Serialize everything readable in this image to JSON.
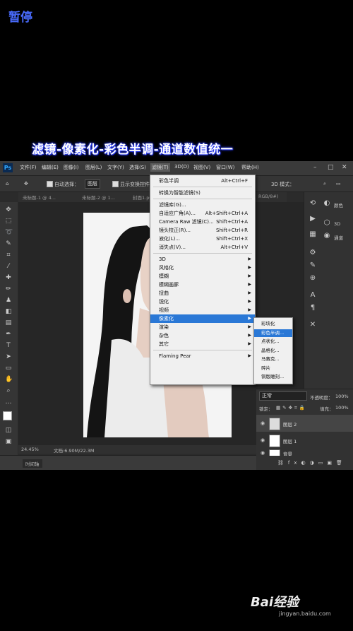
{
  "overlay": {
    "pause_label": "暂停",
    "caption": "滤镜-像素化-彩色半调-通道数值统一"
  },
  "app": {
    "logo": "Ps",
    "menus": [
      "文件(F)",
      "编辑(E)",
      "图像(I)",
      "图层(L)",
      "文字(Y)",
      "选择(S)",
      "滤镜(T)",
      "3D(D)",
      "视图(V)",
      "窗口(W)",
      "帮助(H)"
    ],
    "active_menu_index": 6
  },
  "options_bar": {
    "auto_select_label": "自动选择：",
    "auto_select_value": "图层",
    "show_transform_label": "显示变换控件",
    "mode_3d_label": "3D 模式："
  },
  "tabs": [
    "未标题-1 @ 4...",
    "未标题-2 @ 1...",
    "封面1.psd",
    "RGB/8#)"
  ],
  "status": {
    "zoom": "24.45%",
    "doc_size": "文档:6.90M/22.3M",
    "timeline_label": "时间轴"
  },
  "filter_menu": {
    "items": [
      {
        "label": "彩色半调",
        "shortcut": "Alt+Ctrl+F"
      },
      {
        "sep": true
      },
      {
        "label": "转换为智能滤镜(S)"
      },
      {
        "sep": true
      },
      {
        "label": "滤镜库(G)..."
      },
      {
        "label": "自适应广角(A)...",
        "shortcut": "Alt+Shift+Ctrl+A"
      },
      {
        "label": "Camera Raw 滤镜(C)...",
        "shortcut": "Shift+Ctrl+A"
      },
      {
        "label": "镜头校正(R)...",
        "shortcut": "Shift+Ctrl+R"
      },
      {
        "label": "液化(L)...",
        "shortcut": "Shift+Ctrl+X"
      },
      {
        "label": "消失点(V)...",
        "shortcut": "Alt+Ctrl+V"
      },
      {
        "sep": true
      },
      {
        "label": "3D",
        "submenu": true
      },
      {
        "label": "风格化",
        "submenu": true
      },
      {
        "label": "模糊",
        "submenu": true
      },
      {
        "label": "模糊画廊",
        "submenu": true
      },
      {
        "label": "扭曲",
        "submenu": true
      },
      {
        "label": "锐化",
        "submenu": true
      },
      {
        "label": "视频",
        "submenu": true
      },
      {
        "label": "像素化",
        "submenu": true,
        "highlight": true
      },
      {
        "label": "渲染",
        "submenu": true
      },
      {
        "label": "杂色",
        "submenu": true
      },
      {
        "label": "其它",
        "submenu": true
      },
      {
        "sep": true
      },
      {
        "label": "Flaming Pear",
        "submenu": true
      }
    ]
  },
  "pixelate_submenu": {
    "items": [
      "彩块化",
      "彩色半调...",
      "点状化...",
      "晶格化...",
      "马赛克...",
      "碎片",
      "铜版雕刻..."
    ],
    "highlight_index": 1
  },
  "right_panels": {
    "color_label": "颜色",
    "threed_label": "3D",
    "channels_label": "通道"
  },
  "layers_panel": {
    "blend_mode": "正常",
    "opacity_label": "不透明度：",
    "opacity_value": "100%",
    "lock_label": "锁定：",
    "fill_label": "填充：",
    "fill_value": "100%",
    "layers": [
      {
        "name": "图层 2",
        "selected": true
      },
      {
        "name": "图层 1",
        "selected": false
      },
      {
        "name": "背景",
        "selected": false
      }
    ]
  },
  "watermark": {
    "brand": "Bai经验",
    "url": "jingyan.baidu.com"
  }
}
